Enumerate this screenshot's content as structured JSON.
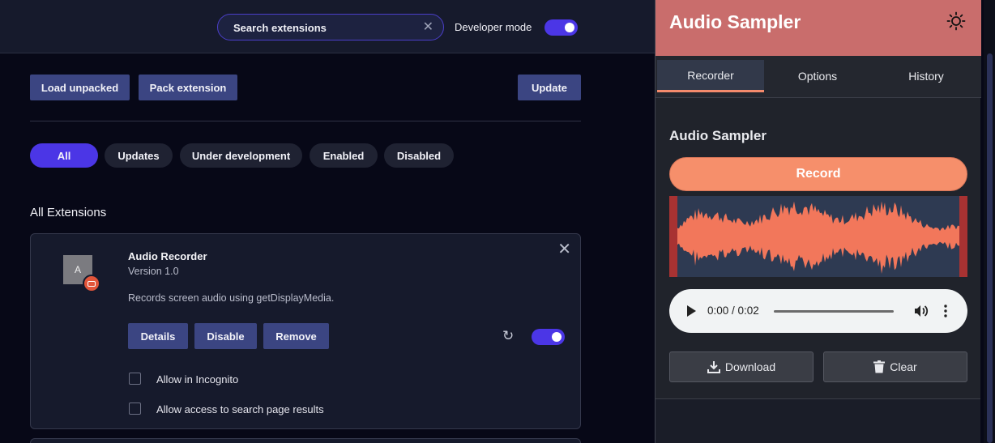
{
  "topbar": {
    "search_text": "Search extensions",
    "developer_mode_label": "Developer mode",
    "developer_mode_on": true
  },
  "toolbar": {
    "load_unpacked": "Load unpacked",
    "pack_extension": "Pack extension",
    "update": "Update"
  },
  "filters": [
    "All",
    "Updates",
    "Under development",
    "Enabled",
    "Disabled"
  ],
  "section_title": "All Extensions",
  "extension": {
    "icon_letter": "A",
    "name": "Audio Recorder",
    "version": "Version 1.0",
    "description": "Records screen audio using getDisplayMedia.",
    "buttons": {
      "details": "Details",
      "disable": "Disable",
      "remove": "Remove"
    },
    "enabled": true,
    "options": [
      "Allow in Incognito",
      "Allow access to search page results"
    ]
  },
  "popup": {
    "title": "Audio Sampler",
    "tabs": [
      "Recorder",
      "Options",
      "History"
    ],
    "active_tab": "Recorder",
    "panel_title": "Audio Sampler",
    "record_label": "Record",
    "audio_time": "0:00 / 0:02",
    "download_label": "Download",
    "clear_label": "Clear",
    "colors": {
      "header": "#c96d6c",
      "accent": "#f68f6b",
      "wave_bg": "#2e3a52"
    }
  }
}
